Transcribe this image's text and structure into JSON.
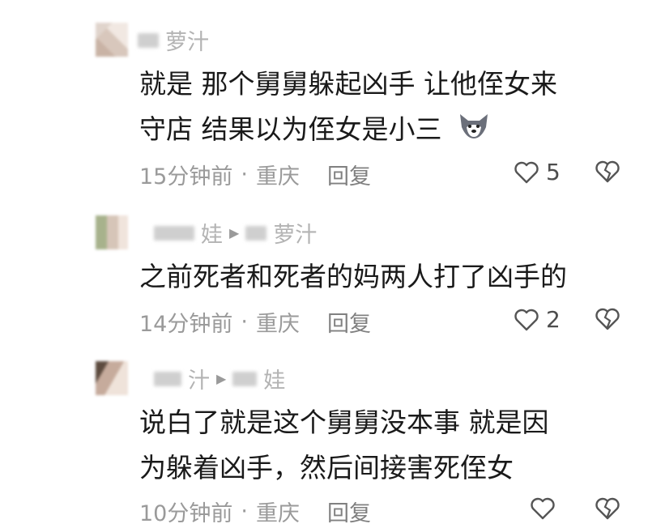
{
  "comments": [
    {
      "username": "萝汁",
      "text_lines": [
        "就是 那个舅舅躲起凶手 让他侄女来",
        "守店 结果以为侄女是小三"
      ],
      "emoji": "husky-emoji-icon",
      "time": "15分钟前",
      "location": "重庆",
      "reply_label": "回复",
      "likes": "5"
    },
    {
      "username": "娃",
      "reply_to": "萝汁",
      "text_lines": [
        "之前死者和死者的妈两人打了凶手的"
      ],
      "time": "14分钟前",
      "location": "重庆",
      "reply_label": "回复",
      "likes": "2"
    },
    {
      "username": "汁",
      "reply_to": "娃",
      "text_lines": [
        "说白了就是这个舅舅没本事 就是因",
        "为躲着凶手，然后间接害死侄女"
      ],
      "time": "10分钟前",
      "location": "重庆",
      "reply_label": "回复",
      "likes": ""
    }
  ],
  "separator": "·"
}
